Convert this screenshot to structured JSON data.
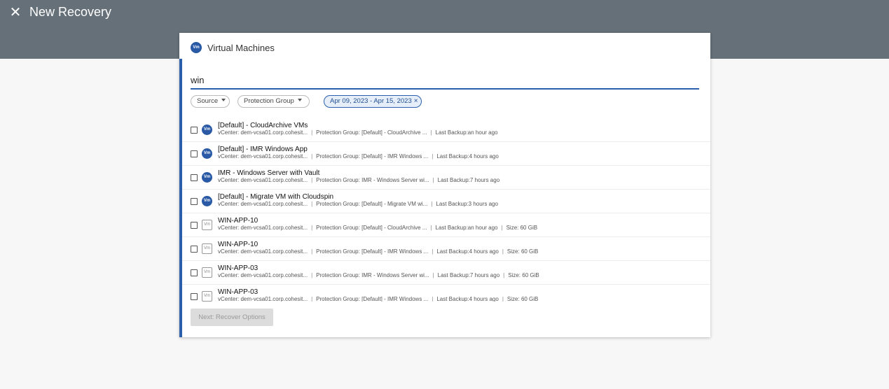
{
  "page": {
    "title": "New Recovery",
    "close_icon": "close-icon"
  },
  "dialog": {
    "title": "Virtual Machines",
    "title_badge": "Vm",
    "search": {
      "value": "win",
      "placeholder": ""
    },
    "filters": {
      "source": "Source",
      "protection_group": "Protection Group",
      "date_range": "Apr 09, 2023 - Apr 15, 2023",
      "date_clear": "×"
    },
    "meta_labels": {
      "vcenter": "vCenter:",
      "protection_group": "Protection Group:",
      "last_backup": "Last Backup:",
      "size": "Size:"
    },
    "rows": [
      {
        "kind": "pg",
        "badge": "Vm",
        "name": "[Default] - CloudArchive VMs",
        "vcenter": "dem-vcsa01.corp.cohesit...",
        "pg": "[Default] - CloudArchive ...",
        "last_backup": "an hour ago",
        "size": ""
      },
      {
        "kind": "pg",
        "badge": "Vm",
        "name": "[Default] - IMR Windows App",
        "vcenter": "dem-vcsa01.corp.cohesit...",
        "pg": "[Default] - IMR Windows ...",
        "last_backup": "4 hours ago",
        "size": ""
      },
      {
        "kind": "pg",
        "badge": "Vm",
        "name": "IMR - Windows Server with Vault",
        "vcenter": "dem-vcsa01.corp.cohesit...",
        "pg": "IMR - Windows Server wi...",
        "last_backup": "7 hours ago",
        "size": ""
      },
      {
        "kind": "pg",
        "badge": "Vm",
        "name": "[Default] - Migrate VM with Cloudspin",
        "vcenter": "dem-vcsa01.corp.cohesit...",
        "pg": "[Default] - Migrate VM wi...",
        "last_backup": "3 hours ago",
        "size": ""
      },
      {
        "kind": "vm",
        "badge": "Vm",
        "name": "WIN-APP-10",
        "vcenter": "dem-vcsa01.corp.cohesit...",
        "pg": "[Default] - CloudArchive ...",
        "last_backup": "an hour ago",
        "size": "60 GiB"
      },
      {
        "kind": "vm",
        "badge": "Vm",
        "name": "WIN-APP-10",
        "vcenter": "dem-vcsa01.corp.cohesit...",
        "pg": "[Default] - IMR Windows ...",
        "last_backup": "4 hours ago",
        "size": "60 GiB"
      },
      {
        "kind": "vm",
        "badge": "Vm",
        "name": "WIN-APP-03",
        "vcenter": "dem-vcsa01.corp.cohesit...",
        "pg": "IMR - Windows Server wi...",
        "last_backup": "7 hours ago",
        "size": "60 GiB"
      },
      {
        "kind": "vm",
        "badge": "Vm",
        "name": "WIN-APP-03",
        "vcenter": "dem-vcsa01.corp.cohesit...",
        "pg": "[Default] - IMR Windows ...",
        "last_backup": "4 hours ago",
        "size": "60 GiB"
      }
    ],
    "next_button": "Next: Recover Options"
  },
  "colors": {
    "header_bg": "#657079",
    "accent": "#2b5fab",
    "badge": "#2a5aa5"
  }
}
